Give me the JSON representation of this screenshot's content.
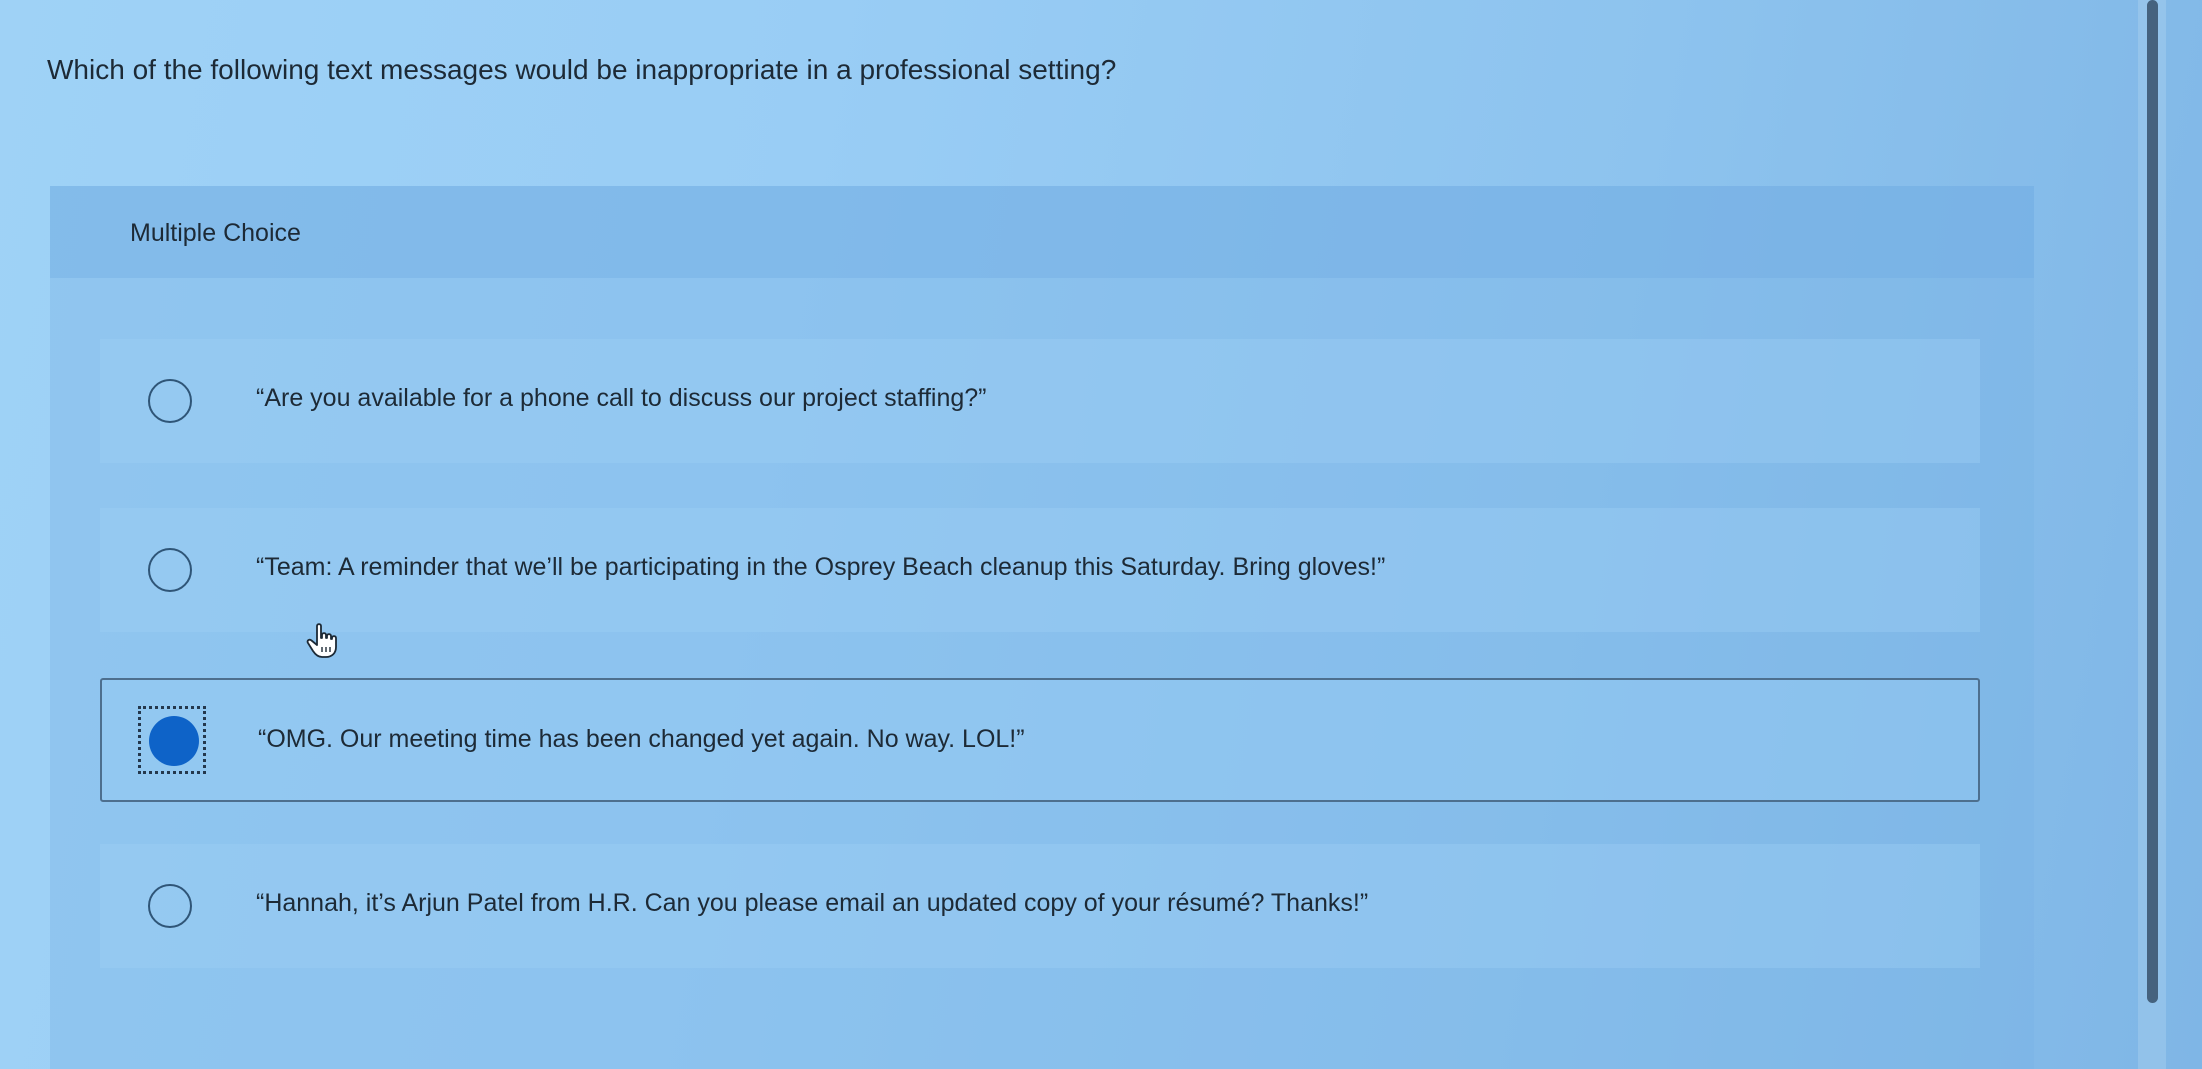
{
  "question": {
    "text": "Which of the following text messages would be inappropriate in a professional setting?"
  },
  "card": {
    "header_label": "Multiple Choice"
  },
  "options": [
    {
      "text": "“Are you available for a phone call to discuss our project staffing?”",
      "selected": false
    },
    {
      "text": "“Team: A reminder that we’ll be participating in the Osprey Beach cleanup this Saturday. Bring gloves!”",
      "selected": false
    },
    {
      "text": "“OMG. Our meeting time has been changed yet again. No way. LOL!”",
      "selected": true
    },
    {
      "text": "“Hannah, it’s Arjun Patel from H.R. Can you please email an updated copy of your résumé? Thanks!”",
      "selected": false
    }
  ],
  "colors": {
    "selected_radio": "#0e63c8",
    "selected_border": "#4d6f8e"
  },
  "icons": {
    "cursor": "hand-pointer-icon"
  }
}
